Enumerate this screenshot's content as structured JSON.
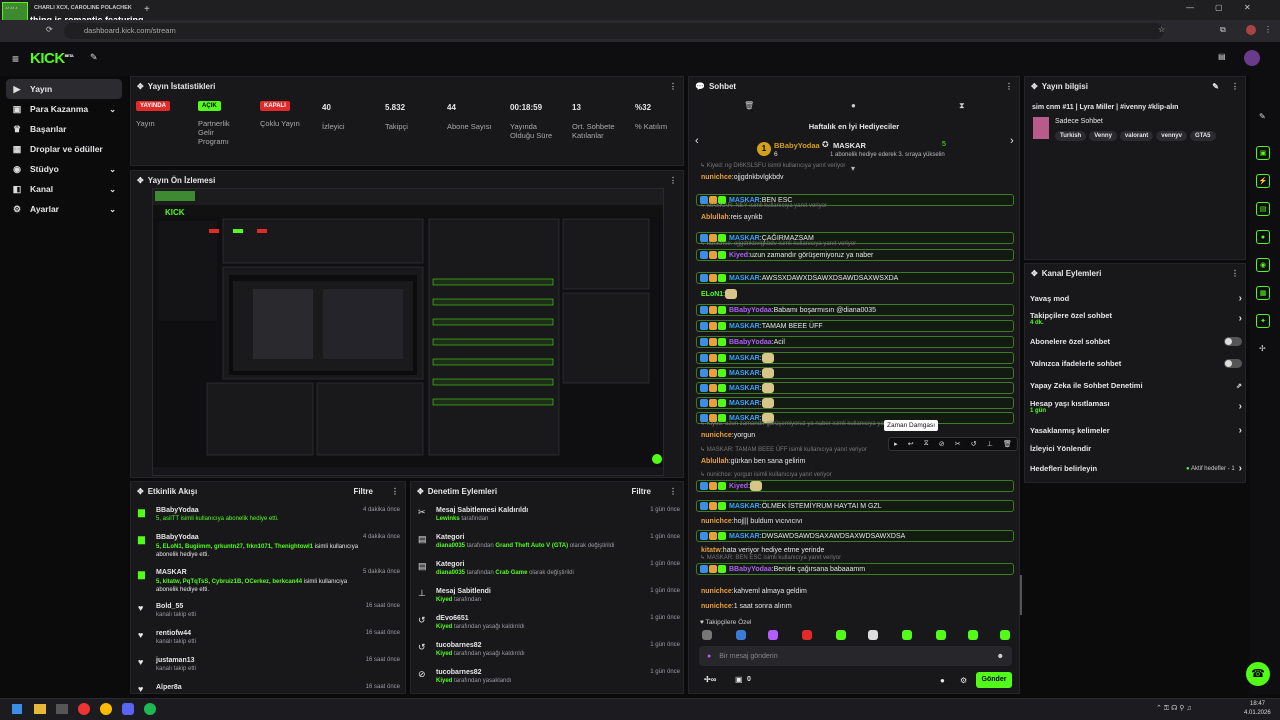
{
  "browser": {
    "tab_subtitle": "CHARLI XCX, CAROLINE POLACHEK",
    "tab_title": "thing is romantic featuring",
    "url": "dashboard.kick.com/stream"
  },
  "app": {
    "logo": "KICK",
    "logo_sup": "BETA"
  },
  "sidebar": {
    "items": [
      {
        "label": "Yayın",
        "icon": "video-icon"
      },
      {
        "label": "Para Kazanma",
        "icon": "money-icon"
      },
      {
        "label": "Başarılar",
        "icon": "trophy-icon"
      },
      {
        "label": "Droplar ve ödüller",
        "icon": "gift-icon"
      },
      {
        "label": "Stüdyo",
        "icon": "studio-icon"
      },
      {
        "label": "Kanal",
        "icon": "channel-icon"
      },
      {
        "label": "Ayarlar",
        "icon": "gear-icon"
      }
    ]
  },
  "stats": {
    "title": "Yayın İstatistikleri",
    "items": [
      {
        "value": "YAYINDA",
        "label": "Yayın",
        "badge": "red"
      },
      {
        "value": "AÇIK",
        "label": "Partnerlik Gelir Programı",
        "badge": "green"
      },
      {
        "value": "KAPALI",
        "label": "Çoklu Yayın",
        "badge": "red"
      },
      {
        "value": "40",
        "label": "İzleyici"
      },
      {
        "value": "5.832",
        "label": "Takipçi"
      },
      {
        "value": "44",
        "label": "Abone Sayısı"
      },
      {
        "value": "00:18:59",
        "label": "Yayında Olduğu Süre"
      },
      {
        "value": "13",
        "label": "Ort. Sohbete Katılanlar"
      },
      {
        "value": "%32",
        "label": "% Katılım"
      }
    ]
  },
  "preview": {
    "title": "Yayın Ön İzlemesi"
  },
  "activity": {
    "title": "Etkinlik Akışı",
    "filter": "Filtre",
    "items": [
      {
        "user": "BBabyYodaa",
        "time": "4 dakika önce",
        "text": "5, asilTT isimli kullanıcıya abonelik hediye etti.",
        "icon": "gift-icon"
      },
      {
        "user": "BBabyYodaa",
        "time": "4 dakika önce",
        "hl": "5, ELoN1, Bugiimm, grkuntn27, frkn1071, Thenightowl1",
        "text": " isimli kullanıcıya abonelik hediye etti.",
        "icon": "gift-icon"
      },
      {
        "user": "MASKAR",
        "time": "5 dakika önce",
        "hl": "5, kitatw, PqTqTsS, Cybruiz1B, OCerkez, berkcan44",
        "text": " isimli kullanıcıya abonelik hediye etti.",
        "icon": "gift-icon"
      },
      {
        "user": "Bold_55",
        "time": "16 saat önce",
        "text": "kanalı takip etti",
        "icon": "heart-icon"
      },
      {
        "user": "rentiofw44",
        "time": "16 saat önce",
        "text": "kanalı takip etti",
        "icon": "heart-icon"
      },
      {
        "user": "justaman13",
        "time": "16 saat önce",
        "text": "kanalı takip etti",
        "icon": "heart-icon"
      },
      {
        "user": "Alper8a",
        "time": "16 saat önce",
        "text": "",
        "icon": "heart-icon"
      }
    ]
  },
  "moderation": {
    "title": "Denetim Eylemleri",
    "filter": "Filtre",
    "items": [
      {
        "title": "Mesaj Sabitlemesi Kaldırıldı",
        "user": "Lewinks",
        "text": "tarafından",
        "time": "1 gün önce",
        "icon": "unpin-icon"
      },
      {
        "title": "Kategori",
        "user": "diana0035",
        "text": "tarafından",
        "hl": "Grand Theft Auto V (GTA)",
        "text2": "olarak değiştirildi",
        "time": "1 gün önce",
        "icon": "category-icon"
      },
      {
        "title": "Kategori",
        "user": "diana0035",
        "text": "tarafından",
        "hl": "Crab Game",
        "text2": "olarak değiştirildi",
        "time": "1 gün önce",
        "icon": "category-icon"
      },
      {
        "title": "Mesaj Sabitlendi",
        "user": "Kiyed",
        "text": "tarafından",
        "time": "1 gün önce",
        "icon": "pin-icon"
      },
      {
        "title": "dEvo6651",
        "user": "Kiyed",
        "text": "tarafından yasağı kaldırıldı",
        "time": "1 gün önce",
        "icon": "unban-icon"
      },
      {
        "title": "tucobarnes82",
        "user": "Kiyed",
        "text": "tarafından yasağı kaldırıldı",
        "time": "1 gün önce",
        "icon": "unban-icon"
      },
      {
        "title": "tucobarnes82",
        "user": "Kiyed",
        "text": "tarafından yasaklandı",
        "time": "1 gün önce",
        "icon": "ban-icon"
      }
    ]
  },
  "chat": {
    "title": "Sohbet",
    "top_title": "Haftalık en İyi Hediyeciler",
    "top_user": "BBabyYodaa",
    "top_user_count": "6",
    "top_user2": "MASKAR",
    "top_count2": "5",
    "promo": "1 abonelik hediye ederek 3. sıraya yükselin",
    "tooltip": "Zaman Damgası",
    "messages": [
      {
        "reply": "Kiyed: ng DI6KSLSFU isimli kullanıcıya yanıt veriyor",
        "user": "nunichce",
        "ucolor": "#e8a03b",
        "text": "ojjgdnkbvlgkbdv",
        "hl": false
      },
      {
        "user": "MASKAR",
        "ucolor": "#3aa0ff",
        "text": "BEN ESC",
        "hl": true
      },
      {
        "reply": "MASKAR: NEY isimli kullanıcıya yanıt veriyor",
        "user": "Ablullah",
        "ucolor": "#e8a03b",
        "text": "reis aynkb",
        "hl": false
      },
      {
        "user": "MASKAR",
        "ucolor": "#3aa0ff",
        "text": "ÇAĞIRMAZSAM",
        "hl": true
      },
      {
        "reply": "nunichce: ojjgdnkbvlgkbdv isimli kullanıcıya yanıt veriyor",
        "user": "Kiyed",
        "ucolor": "#b35cff",
        "text": "uzun zamandır görüşemiyoruz ya naber",
        "hl": true
      },
      {
        "user": "MASKAR",
        "ucolor": "#3aa0ff",
        "text": "AWSSXDAWXDSAWXDSAWDSAXWSXDA",
        "hl": true
      },
      {
        "user": "ELoN1",
        "ucolor": "#53fc18",
        "text": "",
        "hl": false
      },
      {
        "user": "BBabyYodaa",
        "ucolor": "#b35cff",
        "text": "Babamı boşarmısın @diana0035",
        "hl": true
      },
      {
        "user": "MASKAR",
        "ucolor": "#3aa0ff",
        "text": "TAMAM BEEE ÜFF",
        "hl": true
      },
      {
        "user": "BBabyYodaa",
        "ucolor": "#b35cff",
        "text": "Acil",
        "hl": true
      },
      {
        "user": "MASKAR",
        "ucolor": "#3aa0ff",
        "text": "",
        "hl": true
      },
      {
        "user": "MASKAR",
        "ucolor": "#3aa0ff",
        "text": "",
        "hl": true
      },
      {
        "user": "MASKAR",
        "ucolor": "#3aa0ff",
        "text": "",
        "hl": true
      },
      {
        "user": "MASKAR",
        "ucolor": "#3aa0ff",
        "text": "",
        "hl": true
      },
      {
        "user": "MASKAR",
        "ucolor": "#3aa0ff",
        "text": "",
        "hl": true
      },
      {
        "reply": "Kiyed: uzun zamandır görüşemiyoruz ya naber isimli kullanıcıya yanıt veriyor",
        "user": "nunichce",
        "ucolor": "#e8a03b",
        "text": "yorgun",
        "hl": false
      },
      {
        "reply": "MASKAR: TAMAM BEEE ÜFF isimli kullanıcıya yanıt veriyor",
        "user": "Ablullah",
        "ucolor": "#e8a03b",
        "text": "gürkan ben sana gelirim",
        "hl": false
      },
      {
        "reply": "nunichce: yorgun isimli kullanıcıya yanıt veriyor",
        "user": "Kiyed",
        "ucolor": "#b35cff",
        "text": "",
        "hl": true
      },
      {
        "user": "MASKAR",
        "ucolor": "#3aa0ff",
        "text": "ÖLMEK İSTEMİYRUM HAYTAI M GZL",
        "hl": true
      },
      {
        "user": "nunichce",
        "ucolor": "#e8a03b",
        "text": "hoj||| buldum vıcıvıcıvı",
        "hl": false
      },
      {
        "user": "MASKAR",
        "ucolor": "#3aa0ff",
        "text": "DWSAWDSAWDSAXAWDSAXWDSAWXDSA",
        "hl": true
      },
      {
        "user": "kitatw",
        "ucolor": "#e8a03b",
        "text": "hata veriyor hediye etme yerinde",
        "hl": false
      },
      {
        "reply": "MASKAR: BEN ESC isimli kullanıcıya yanıt veriyor",
        "user": "BBabyYodaa",
        "ucolor": "#b35cff",
        "text": "Benide çağırsana babaaamm",
        "hl": true
      },
      {
        "user": "nunichce",
        "ucolor": "#e8a03b",
        "text": "kahveml almaya geldim",
        "hl": false
      },
      {
        "user": "nunichce",
        "ucolor": "#e8a03b",
        "text": "1 saat sonra alırım",
        "hl": false
      }
    ],
    "emote_label": "Takipçilere Özel",
    "input_placeholder": "Bir mesaj gönderin",
    "send": "Gönder",
    "count": "0"
  },
  "stream_info": {
    "title": "Yayın bilgisi",
    "stream_title": "sim cnm #11 | Lyra Miller | #ivenny #klip-alın",
    "chat_mode": "Sadece Sohbet",
    "tags": [
      "Turkish",
      "Venny",
      "valorant",
      "vennyv",
      "GTA5"
    ]
  },
  "channel_actions": {
    "title": "Kanal Eylemleri",
    "items": [
      {
        "label": "Yavaş mod",
        "type": "chevron"
      },
      {
        "label": "Takipçilere özel sohbet",
        "sub": "4 dk.",
        "type": "chevron"
      },
      {
        "label": "Abonelere özel sohbet",
        "type": "toggle"
      },
      {
        "label": "Yalnızca ifadelerle sohbet",
        "type": "toggle"
      },
      {
        "label": "Yapay Zeka ile Sohbet Denetimi",
        "type": "external"
      },
      {
        "label": "Hesap yaşı kısıtlaması",
        "sub": "1 gün",
        "type": "chevron"
      },
      {
        "label": "Yasaklanmış kelimeler",
        "type": "chevron"
      },
      {
        "label": "İzleyici Yönlendir",
        "type": "none"
      },
      {
        "label": "Hedefleri belirleyin",
        "type": "goal",
        "note": "Aktif hedefler - 1"
      }
    ]
  },
  "taskbar": {
    "time": "18:47",
    "date": "4.01.2026"
  },
  "colors": {
    "accent": "#53fc18",
    "bg": "#0e0e10",
    "panel": "#18181b",
    "live_red": "#e22a2a"
  }
}
